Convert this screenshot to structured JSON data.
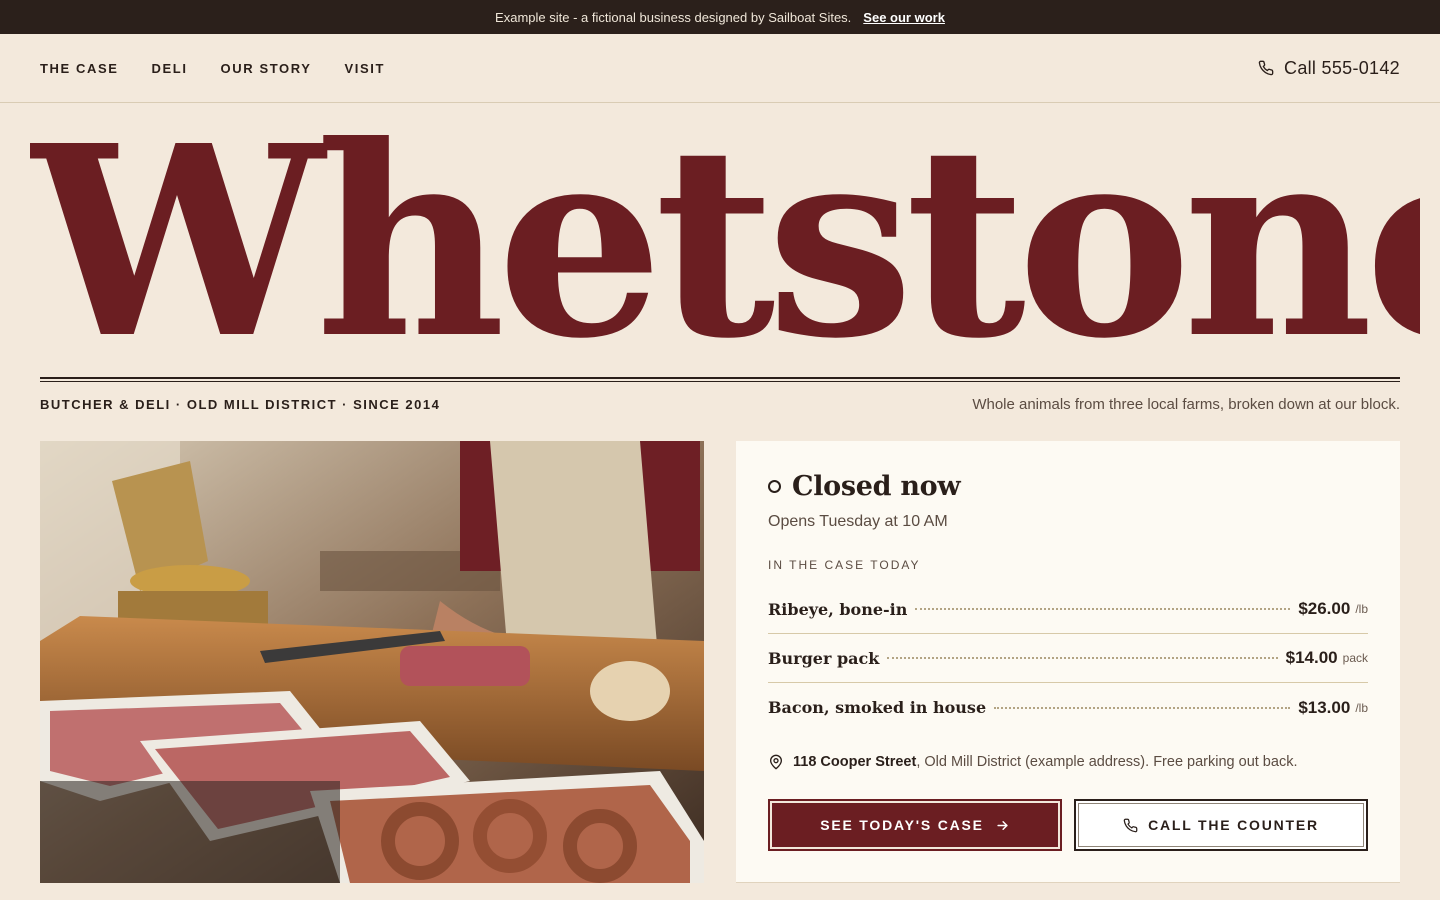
{
  "banner": {
    "message": "Example site - a fictional business designed by Sailboat Sites.",
    "link": "See our work"
  },
  "nav": {
    "links": [
      "THE CASE",
      "DELI",
      "OUR STORY",
      "VISIT"
    ],
    "phone": "Call 555-0142",
    "phone_icon": "phone-icon"
  },
  "hero": {
    "wordmark": "Whetstone",
    "tagline": "BUTCHER & DELI · OLD MILL DISTRICT · SINCE 2014",
    "promise": "Whole animals from three local farms, broken down at our block."
  },
  "status": {
    "title": "Closed now",
    "subtitle": "Opens Tuesday at 10 AM",
    "indicator_icon": "circle-status-icon"
  },
  "case": {
    "heading": "IN THE CASE TODAY",
    "items": [
      {
        "name": "Ribeye, bone-in",
        "price": "$26.00",
        "unit": "/lb"
      },
      {
        "name": "Burger pack",
        "price": "$14.00",
        "unit": "pack"
      },
      {
        "name": "Bacon, smoked in house",
        "price": "$13.00",
        "unit": "/lb"
      }
    ]
  },
  "address": {
    "street": "118 Cooper Street",
    "rest": ", Old Mill District (example address). Free parking out back.",
    "icon": "map-pin-icon"
  },
  "buttons": {
    "primary": "SEE TODAY'S CASE",
    "primary_icon": "arrow-right-icon",
    "secondary": "CALL THE COUNTER",
    "secondary_icon": "phone-icon"
  },
  "colors": {
    "brand": "#6b1e22",
    "banner_bg": "#2b201b",
    "page_bg": "#f3e9dc",
    "card_bg": "#fdfaf3",
    "text": "#2a1f1a"
  }
}
